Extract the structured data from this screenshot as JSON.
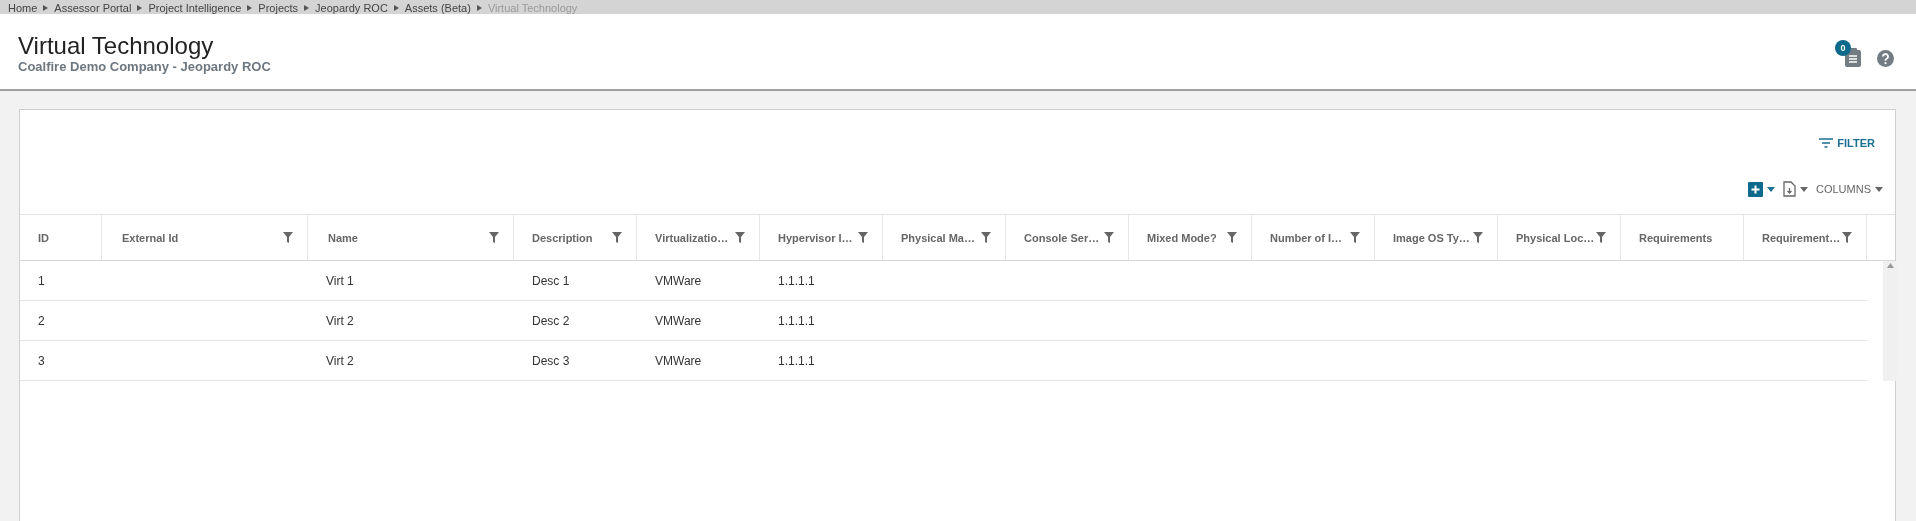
{
  "breadcrumb": [
    {
      "label": "Home",
      "current": false
    },
    {
      "label": "Assessor Portal",
      "current": false
    },
    {
      "label": "Project Intelligence",
      "current": false
    },
    {
      "label": "Projects",
      "current": false
    },
    {
      "label": "Jeopardy ROC",
      "current": false
    },
    {
      "label": "Assets (Beta)",
      "current": false
    },
    {
      "label": "Virtual Technology",
      "current": true
    }
  ],
  "header": {
    "title": "Virtual Technology",
    "subtitle": "Coalfire Demo Company - Jeopardy ROC",
    "notification_count": "0"
  },
  "toolbar": {
    "filter_label": "FILTER",
    "columns_label": "COLUMNS"
  },
  "table": {
    "columns": [
      {
        "label": "ID",
        "filter": false,
        "cells": [
          "1",
          "2",
          "3"
        ]
      },
      {
        "label": "External Id",
        "filter": true
      },
      {
        "label": "Name",
        "filter": true,
        "cells": [
          "Virt 1",
          "Virt 2",
          "Virt 2"
        ]
      },
      {
        "label": "Description",
        "filter": true,
        "cells": [
          "Desc 1",
          "Desc 2",
          "Desc 3"
        ]
      },
      {
        "label": "Virtualizatio…",
        "filter": true,
        "cells": [
          "VMWare",
          "VMWare",
          "VMWare"
        ]
      },
      {
        "label": "Hypervisor I…",
        "filter": true,
        "cells": [
          "1.1.1.1",
          "1.1.1.1",
          "1.1.1.1"
        ]
      },
      {
        "label": "Physical Ma…",
        "filter": true
      },
      {
        "label": "Console Ser…",
        "filter": true
      },
      {
        "label": "Mixed Mode?",
        "filter": true
      },
      {
        "label": "Number of I…",
        "filter": true
      },
      {
        "label": "Image OS Ty…",
        "filter": true
      },
      {
        "label": "Physical Loc…",
        "filter": true
      },
      {
        "label": "Requirements",
        "filter": false
      },
      {
        "label": "Requirement…",
        "filter": true
      }
    ]
  }
}
